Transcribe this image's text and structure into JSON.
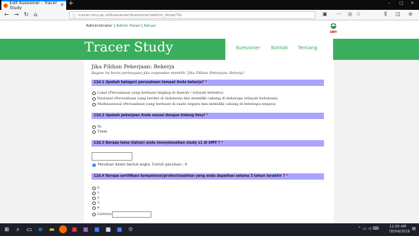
{
  "browser": {
    "tab_title": "Edit Kuesioner - Tracer Study",
    "new_tab": "+",
    "url": "tracer.umy.ac.id/kuesioner/kuesioner/admin_show/?lb",
    "window_controls": [
      "–",
      "□",
      "✕"
    ]
  },
  "admin": {
    "prefix": "Administrator | ",
    "admin_link": "Admin Panel",
    "sep": " | ",
    "logout_link": "Keluar"
  },
  "logo_text": "UMY",
  "header": {
    "brand": "Tracer Study",
    "menu": [
      "Kuesioner",
      "Kontak",
      "Tentang"
    ]
  },
  "section": {
    "title": "Jika Pilihan Pekerjaan: Bekerja",
    "description": "Bagian ini berisi pertanyaan jika responden memilih \"Jika Pilihan Pekerjaan: Bekerja\""
  },
  "questions": [
    {
      "label": "12d.1 Apakah kategori perusahaan tempat Anda bekerja?",
      "required": "*",
      "options": [
        "Lokal (Perusahaan yang berbasis lingkup di daerah / wilayah tertentu)",
        "Nasional (Perusahaan yang berdiri di Indonesia dan memiliki cabang di beberapa wilayah Indonesia)",
        "Multinasional (Perusahaan yang berbasis di suatu negara dan memiliki cabang di beberapa negara)"
      ]
    },
    {
      "label": "12d.2 Apakah pekerjaan Anda sesuai dengan bidang ilmu?",
      "required": "*",
      "options": [
        "Ya",
        "Tidak"
      ]
    },
    {
      "label": "12d.3 Berapa lama (tahun) anda menyelesaikan study s1 di UMY ?",
      "required": "*",
      "hint": "Penulisan dalam bentuk angka. Contoh penulisan : 4"
    },
    {
      "label": "12d.4 Berapa sertifikasi kompetensi/profesi/keahlian yang anda dapatkan selama 3 tahun terakhir ?",
      "required": "*",
      "options": [
        "0",
        "1",
        "2",
        "3",
        "4",
        "Lainnya:"
      ]
    }
  ],
  "taskbar": {
    "time": "12:00 AM",
    "date": "05/04/2019"
  },
  "colors": {
    "green": "#3bae5e",
    "question_bar": "#aba4ff",
    "taskbar": "#1b1f2a"
  }
}
